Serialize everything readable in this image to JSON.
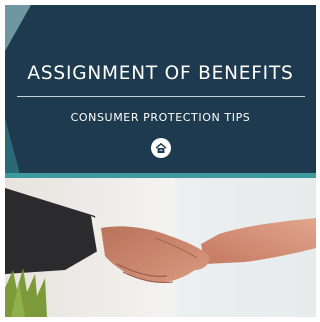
{
  "banner": {
    "title": "ASSIGNMENT OF BENEFITS",
    "subtitle": "CONSUMER PROTECTION TIPS",
    "logo_icon": "house-logo-icon",
    "background_color": "#1d3a4e",
    "accent_color": "#3f9aa0"
  },
  "photo": {
    "subject": "handshake-photo",
    "colors": {
      "sleeve_dark": "#2b2a2d",
      "skin": "#c9856c",
      "background": "#eceff0",
      "plant": "#7c9a3a"
    }
  }
}
